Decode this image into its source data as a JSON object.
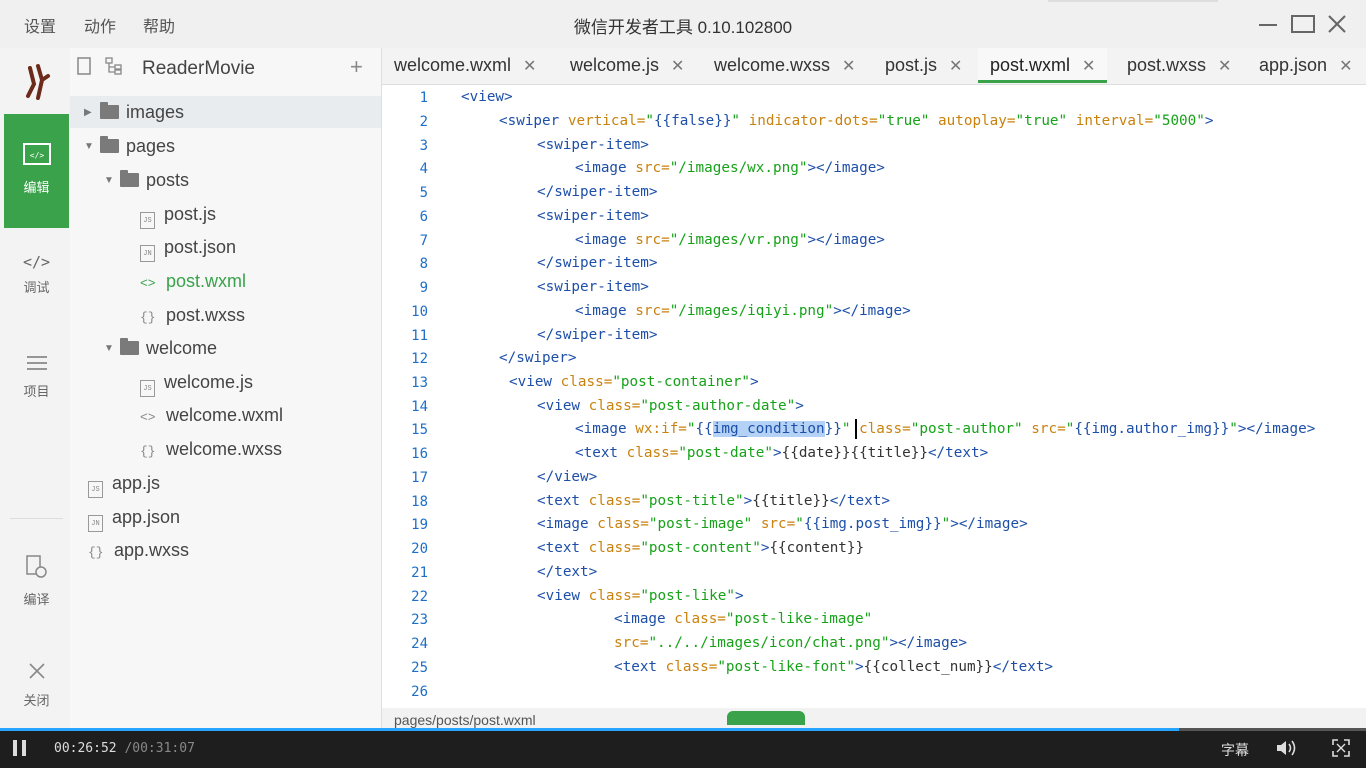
{
  "titlebar": {
    "menu": [
      "设置",
      "动作",
      "帮助"
    ],
    "title": "微信开发者工具 0.10.102800"
  },
  "rail": {
    "items": [
      {
        "label": "编辑",
        "icon": "editor-icon"
      },
      {
        "label": "调试",
        "icon": "code-icon"
      },
      {
        "label": "项目",
        "icon": "menu-lines-icon"
      },
      {
        "label": "编译",
        "icon": "compile-icon"
      },
      {
        "label": "关闭",
        "icon": "close-icon"
      }
    ]
  },
  "tree": {
    "project": "ReaderMovie",
    "nodes": [
      {
        "label": "images",
        "kind": "folder"
      },
      {
        "label": "pages",
        "kind": "folder"
      },
      {
        "label": "posts",
        "kind": "folder"
      },
      {
        "label": "post.js",
        "kind": "js"
      },
      {
        "label": "post.json",
        "kind": "json"
      },
      {
        "label": "post.wxml",
        "kind": "wxml",
        "active": true
      },
      {
        "label": "post.wxss",
        "kind": "wxss"
      },
      {
        "label": "welcome",
        "kind": "folder"
      },
      {
        "label": "welcome.js",
        "kind": "js"
      },
      {
        "label": "welcome.wxml",
        "kind": "wxml"
      },
      {
        "label": "welcome.wxss",
        "kind": "wxss"
      },
      {
        "label": "app.js",
        "kind": "js"
      },
      {
        "label": "app.json",
        "kind": "json"
      },
      {
        "label": "app.wxss",
        "kind": "wxss"
      }
    ]
  },
  "tabs": [
    {
      "label": "welcome.wxml"
    },
    {
      "label": "welcome.js"
    },
    {
      "label": "welcome.wxss"
    },
    {
      "label": "post.js"
    },
    {
      "label": "post.wxml",
      "active": true
    },
    {
      "label": "post.wxss"
    },
    {
      "label": "app.json"
    }
  ],
  "editor": {
    "line_numbers": [
      "1",
      "2",
      "3",
      "4",
      "5",
      "6",
      "7",
      "8",
      "9",
      "10",
      "11",
      "12",
      "13",
      "14",
      "15",
      "16",
      "17",
      "18",
      "19",
      "20",
      "21",
      "22",
      "23",
      "24",
      "25",
      "26"
    ],
    "selection": "img_condition"
  },
  "status": {
    "path": "pages/posts/post.wxml"
  },
  "player": {
    "current": "00:26:52",
    "total": "/00:31:07",
    "subtitle_label": "字幕",
    "progress": 0.863
  },
  "colors": {
    "accent": "#3aa24a",
    "tag": "#1d4fa8",
    "attr": "#c9820e",
    "string": "#17a21a",
    "progress": "#27a4ff"
  }
}
